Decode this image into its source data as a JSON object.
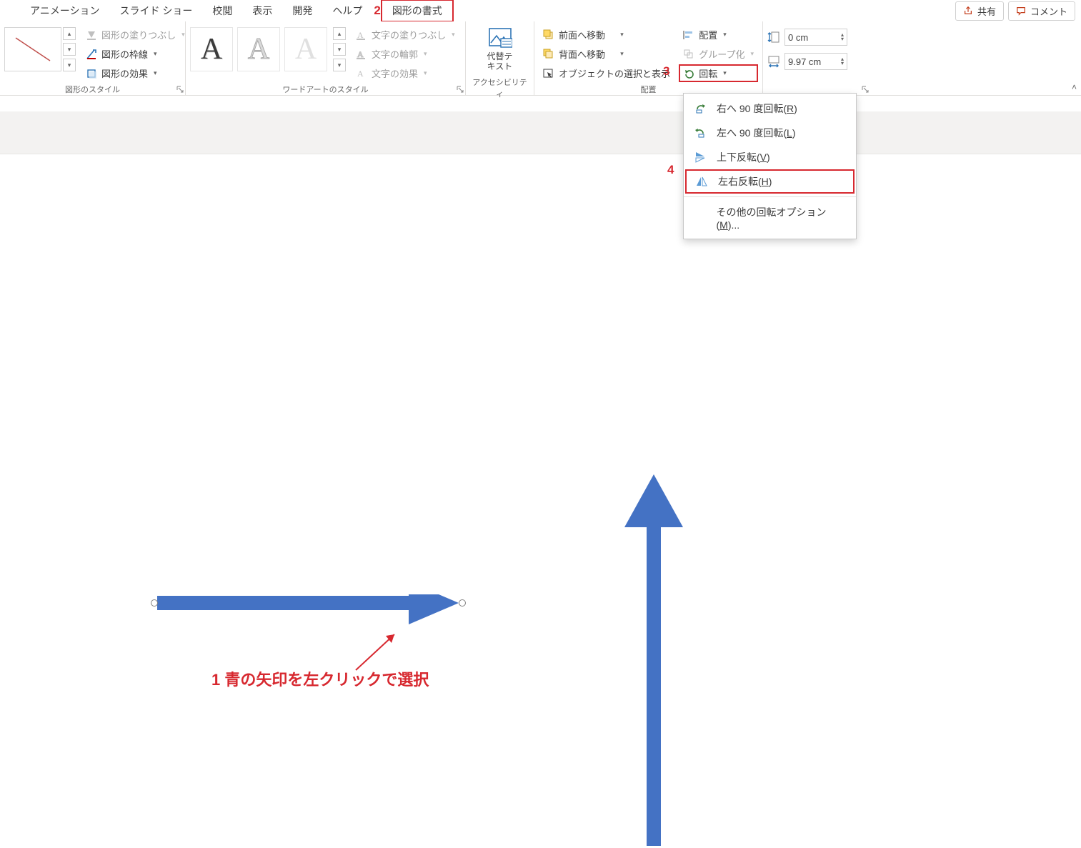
{
  "tabs": {
    "animation": "アニメーション",
    "slideshow": "スライド ショー",
    "review": "校閲",
    "view": "表示",
    "developer": "開発",
    "help": "ヘルプ",
    "shape_format": "図形の書式"
  },
  "topright": {
    "share": "共有",
    "comment": "コメント"
  },
  "annotations": {
    "n1": "1",
    "n2": "2",
    "n3": "3",
    "n4": "4",
    "text1": "青の矢印を左クリックで選択"
  },
  "shape_styles": {
    "fill": "図形の塗りつぶし",
    "outline": "図形の枠線",
    "effects": "図形の効果",
    "group_label": "図形のスタイル"
  },
  "wordart": {
    "text_fill": "文字の塗りつぶし",
    "text_outline": "文字の輪郭",
    "text_effects": "文字の効果",
    "group_label": "ワードアートのスタイル"
  },
  "accessibility": {
    "alt_text_l1": "代替テ",
    "alt_text_l2": "キスト",
    "group_label": "アクセシビリティ"
  },
  "arrange": {
    "bring_forward": "前面へ移動",
    "send_backward": "背面へ移動",
    "selection_pane": "オブジェクトの選択と表示",
    "align": "配置",
    "group": "グループ化",
    "rotate": "回転",
    "group_label": "配置"
  },
  "size": {
    "height": "0 cm",
    "width": "9.97 cm"
  },
  "rotate_menu": {
    "rot_r": "右へ 90 度回転(",
    "rot_r_k": "R",
    "rot_r_end": ")",
    "rot_l": "左へ 90 度回転(",
    "rot_l_k": "L",
    "rot_l_end": ")",
    "flip_v": "上下反転(",
    "flip_v_k": "V",
    "flip_v_end": ")",
    "flip_h": "左右反転(",
    "flip_h_k": "H",
    "flip_h_end": ")",
    "more": "その他の回転オプション(",
    "more_k": "M",
    "more_end": ")..."
  }
}
